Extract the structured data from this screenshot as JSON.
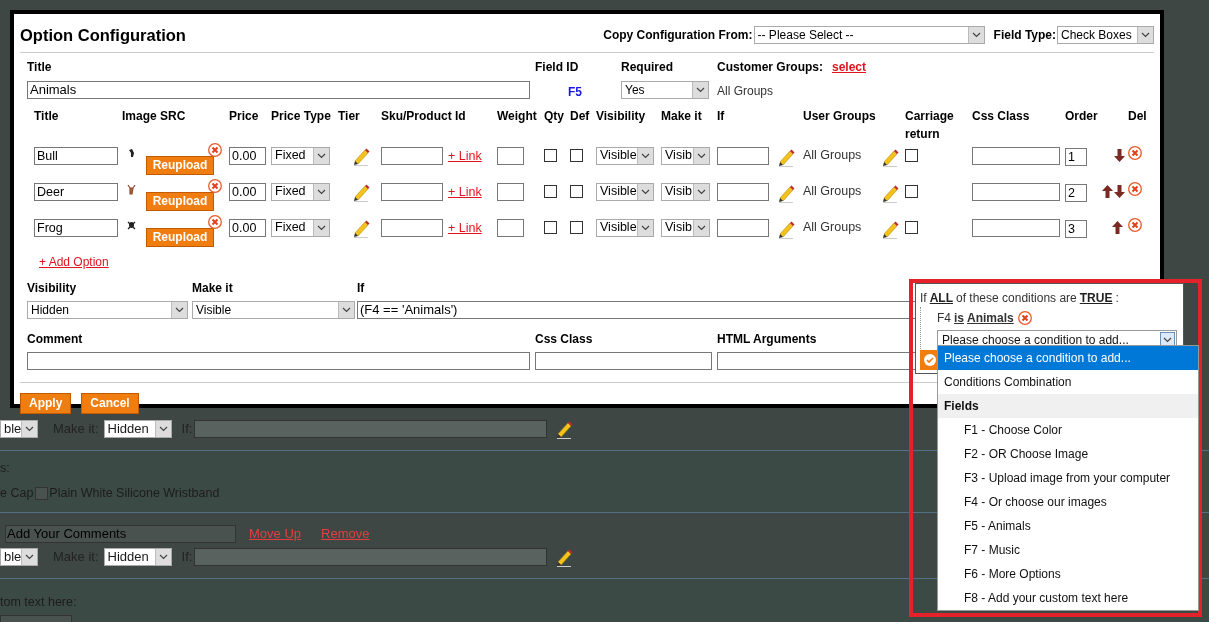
{
  "background_page": {
    "rows": [
      {
        "kind": "rule",
        "visibility": "ble",
        "make_it_label": "Make it:",
        "make_it": "Hidden",
        "if_label": "If:"
      },
      {
        "kind": "checkboxes",
        "label": "s:",
        "leading_text": "e Cap",
        "checkboxes": [
          {
            "label": "Plain White Silicone Wristband",
            "checked": false
          }
        ]
      },
      {
        "kind": "title",
        "value": "Add Your Comments",
        "links": [
          "Move Up",
          "Remove"
        ]
      },
      {
        "kind": "rule",
        "visibility": "ble",
        "make_it_label": "Make it:",
        "make_it": "Hidden",
        "if_label": "If:"
      },
      {
        "kind": "caption",
        "label": "tom text here:"
      }
    ]
  },
  "dialog": {
    "title": "Option Configuration",
    "copy_configuration": {
      "label": "Copy Configuration From:",
      "value": "-- Please Select --"
    },
    "field_type": {
      "label": "Field Type:",
      "value": "Check Boxes"
    },
    "title_field": {
      "label": "Title",
      "value": "Animals"
    },
    "field_id": {
      "label": "Field ID",
      "value": "F5"
    },
    "required": {
      "label": "Required",
      "value": "Yes"
    },
    "customer_groups": {
      "label": "Customer Groups:",
      "link": "select",
      "value": "All Groups"
    },
    "options_table": {
      "columns": [
        "Title",
        "Image SRC",
        "Price",
        "Price Type",
        "Tier",
        "Sku/Product Id",
        "Weight",
        "Qty",
        "Def",
        "Visibility",
        "Make it",
        "If",
        "User Groups",
        "Carriage return",
        "Css Class",
        "Order",
        "Del"
      ],
      "rows": [
        {
          "title": "Bull",
          "button": "Reupload",
          "price": "0.00",
          "price_type": "Fixed",
          "link": "+ Link",
          "qty": false,
          "def": false,
          "visibility": "Visible",
          "make_it": "Visib",
          "user_groups": "All Groups",
          "carriage_return": false,
          "order": "1",
          "move_up": false,
          "move_down": true
        },
        {
          "title": "Deer",
          "button": "Reupload",
          "price": "0.00",
          "price_type": "Fixed",
          "link": "+ Link",
          "qty": false,
          "def": false,
          "visibility": "Visible",
          "make_it": "Visib",
          "user_groups": "All Groups",
          "carriage_return": false,
          "order": "2",
          "move_up": true,
          "move_down": true
        },
        {
          "title": "Frog",
          "button": "Reupload",
          "price": "0.00",
          "price_type": "Fixed",
          "link": "+ Link",
          "qty": false,
          "def": false,
          "visibility": "Visible",
          "make_it": "Visib",
          "user_groups": "All Groups",
          "carriage_return": false,
          "order": "3",
          "move_up": true,
          "move_down": false
        }
      ]
    },
    "add_option": "+ Add Option",
    "visibility": {
      "label": "Visibility",
      "value": "Hidden"
    },
    "make_it": {
      "label": "Make it",
      "value": "Visible"
    },
    "if": {
      "label": "If",
      "value": "(F4 == 'Animals')"
    },
    "comment": {
      "label": "Comment"
    },
    "css_class": {
      "label": "Css Class"
    },
    "html_arguments": {
      "label": "HTML Arguments"
    },
    "buttons": [
      "Apply",
      "Cancel"
    ]
  },
  "condition_editor": {
    "intro": [
      {
        "kind": "text",
        "text": "If"
      },
      {
        "kind": "link",
        "text": "ALL"
      },
      {
        "kind": "text",
        "text": "of these conditions are"
      },
      {
        "kind": "link",
        "text": "TRUE"
      },
      {
        "kind": "text",
        "text": ":"
      }
    ],
    "condition": {
      "field": "F4",
      "operator": "is",
      "value": "Animals"
    },
    "select": {
      "value": "Please choose a condition to add..."
    },
    "options": [
      {
        "kind": "option",
        "label": "Please choose a condition to add...",
        "selected": true
      },
      {
        "kind": "option",
        "label": "Conditions Combination",
        "selected": false
      },
      {
        "kind": "group",
        "label": "Fields"
      },
      {
        "kind": "child",
        "label": "F1 - Choose Color",
        "selected": false
      },
      {
        "kind": "child",
        "label": "F2 - OR Choose Image",
        "selected": false
      },
      {
        "kind": "child",
        "label": "F3 - Upload image from your computer",
        "selected": false
      },
      {
        "kind": "child",
        "label": "F4 - Or choose our images",
        "selected": false
      },
      {
        "kind": "child",
        "label": "F5 - Animals",
        "selected": false
      },
      {
        "kind": "child",
        "label": "F7 - Music",
        "selected": false
      },
      {
        "kind": "child",
        "label": "F6 - More Options",
        "selected": false
      },
      {
        "kind": "child",
        "label": "F8 - Add your custom text here",
        "selected": false
      }
    ]
  }
}
